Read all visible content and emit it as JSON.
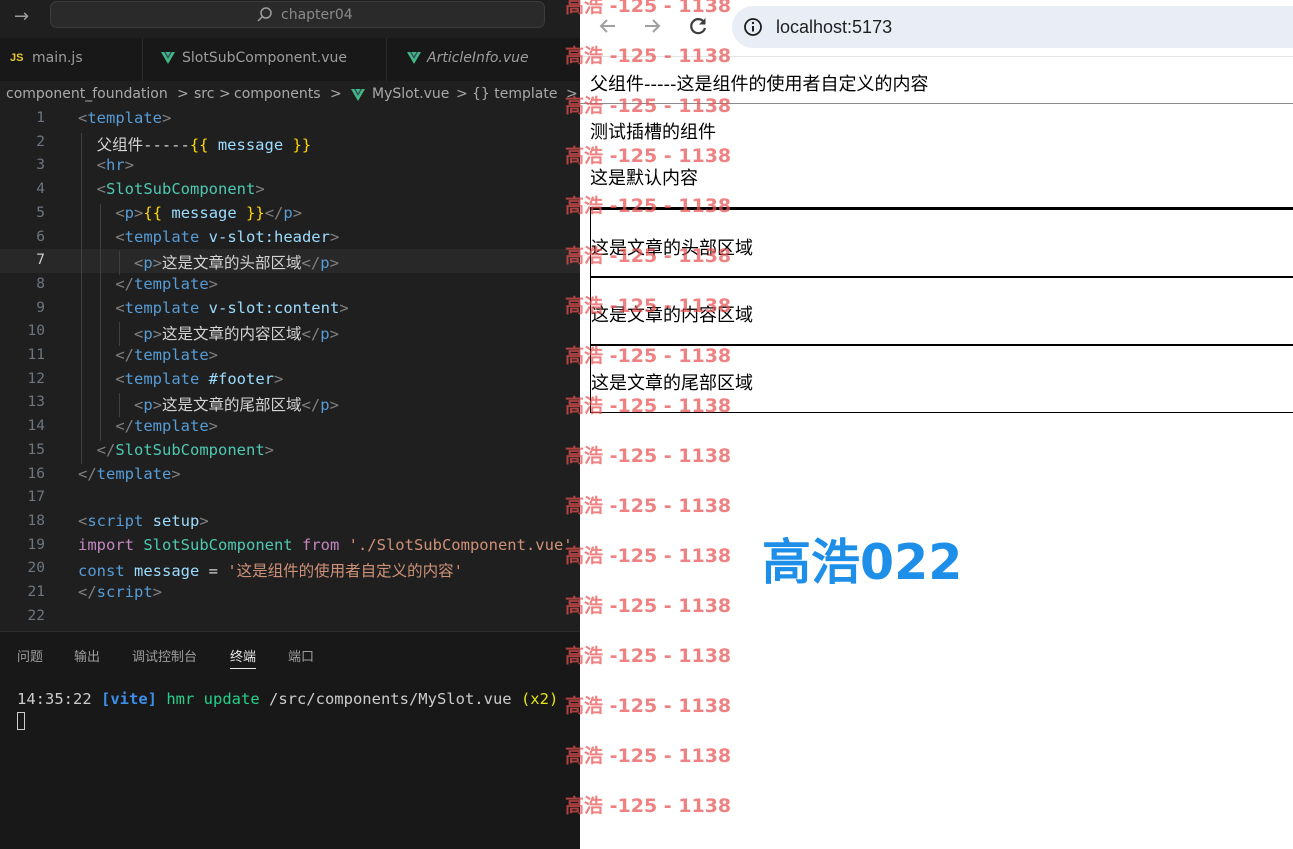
{
  "editor": {
    "command_center_title": "chapter04",
    "tabs": [
      {
        "label": "main.js",
        "type": "js"
      },
      {
        "label": "SlotSubComponent.vue",
        "type": "vue"
      },
      {
        "label": "ArticleInfo.vue",
        "type": "vue"
      }
    ],
    "breadcrumb": [
      "component_foundation",
      ">",
      "src",
      ">",
      "components",
      ">",
      "MySlot.vue",
      ">",
      "{} template",
      ">"
    ],
    "current_line": 7,
    "code_lines": [
      {
        "n": "1",
        "segs": [
          [
            "c-br",
            "<"
          ],
          [
            "c-tag",
            "template"
          ],
          [
            "c-br",
            ">"
          ]
        ]
      },
      {
        "n": "2",
        "segs": [
          [
            "c-txt",
            "  父组件-----"
          ],
          [
            "c-mus",
            "{{"
          ],
          [
            "c-var",
            " message "
          ],
          [
            "c-mus",
            "}}"
          ]
        ]
      },
      {
        "n": "3",
        "segs": [
          [
            "c-txt",
            "  "
          ],
          [
            "c-br",
            "<"
          ],
          [
            "c-tag",
            "hr"
          ],
          [
            "c-br",
            ">"
          ]
        ]
      },
      {
        "n": "4",
        "segs": [
          [
            "c-txt",
            "  "
          ],
          [
            "c-br",
            "<"
          ],
          [
            "c-comp",
            "SlotSubComponent"
          ],
          [
            "c-br",
            ">"
          ]
        ]
      },
      {
        "n": "5",
        "segs": [
          [
            "c-txt",
            "    "
          ],
          [
            "c-br",
            "<"
          ],
          [
            "c-tag",
            "p"
          ],
          [
            "c-br",
            ">"
          ],
          [
            "c-mus",
            "{{"
          ],
          [
            "c-var",
            " message "
          ],
          [
            "c-mus",
            "}}"
          ],
          [
            "c-br",
            "</"
          ],
          [
            "c-tag",
            "p"
          ],
          [
            "c-br",
            ">"
          ]
        ]
      },
      {
        "n": "6",
        "segs": [
          [
            "c-txt",
            "    "
          ],
          [
            "c-br",
            "<"
          ],
          [
            "c-tag",
            "template"
          ],
          [
            "c-attr",
            " v-slot:header"
          ],
          [
            "c-br",
            ">"
          ]
        ]
      },
      {
        "n": "7",
        "segs": [
          [
            "c-txt",
            "      "
          ],
          [
            "c-br",
            "<"
          ],
          [
            "c-tag",
            "p"
          ],
          [
            "c-br",
            ">"
          ],
          [
            "c-txt",
            "这是文章的头部区域"
          ],
          [
            "c-br",
            "</"
          ],
          [
            "c-tag",
            "p"
          ],
          [
            "c-br",
            ">"
          ]
        ]
      },
      {
        "n": "8",
        "segs": [
          [
            "c-txt",
            "    "
          ],
          [
            "c-br",
            "</"
          ],
          [
            "c-tag",
            "template"
          ],
          [
            "c-br",
            ">"
          ]
        ]
      },
      {
        "n": "9",
        "segs": [
          [
            "c-txt",
            "    "
          ],
          [
            "c-br",
            "<"
          ],
          [
            "c-tag",
            "template"
          ],
          [
            "c-attr",
            " v-slot:content"
          ],
          [
            "c-br",
            ">"
          ]
        ]
      },
      {
        "n": "10",
        "segs": [
          [
            "c-txt",
            "      "
          ],
          [
            "c-br",
            "<"
          ],
          [
            "c-tag",
            "p"
          ],
          [
            "c-br",
            ">"
          ],
          [
            "c-txt",
            "这是文章的内容区域"
          ],
          [
            "c-br",
            "</"
          ],
          [
            "c-tag",
            "p"
          ],
          [
            "c-br",
            ">"
          ]
        ]
      },
      {
        "n": "11",
        "segs": [
          [
            "c-txt",
            "    "
          ],
          [
            "c-br",
            "</"
          ],
          [
            "c-tag",
            "template"
          ],
          [
            "c-br",
            ">"
          ]
        ]
      },
      {
        "n": "12",
        "segs": [
          [
            "c-txt",
            "    "
          ],
          [
            "c-br",
            "<"
          ],
          [
            "c-tag",
            "template"
          ],
          [
            "c-attr",
            " #footer"
          ],
          [
            "c-br",
            ">"
          ]
        ]
      },
      {
        "n": "13",
        "segs": [
          [
            "c-txt",
            "      "
          ],
          [
            "c-br",
            "<"
          ],
          [
            "c-tag",
            "p"
          ],
          [
            "c-br",
            ">"
          ],
          [
            "c-txt",
            "这是文章的尾部区域"
          ],
          [
            "c-br",
            "</"
          ],
          [
            "c-tag",
            "p"
          ],
          [
            "c-br",
            ">"
          ]
        ]
      },
      {
        "n": "14",
        "segs": [
          [
            "c-txt",
            "    "
          ],
          [
            "c-br",
            "</"
          ],
          [
            "c-tag",
            "template"
          ],
          [
            "c-br",
            ">"
          ]
        ]
      },
      {
        "n": "15",
        "segs": [
          [
            "c-txt",
            "  "
          ],
          [
            "c-br",
            "</"
          ],
          [
            "c-comp",
            "SlotSubComponent"
          ],
          [
            "c-br",
            ">"
          ]
        ]
      },
      {
        "n": "16",
        "segs": [
          [
            "c-br",
            "</"
          ],
          [
            "c-tag",
            "template"
          ],
          [
            "c-br",
            ">"
          ]
        ]
      },
      {
        "n": "17",
        "segs": []
      },
      {
        "n": "18",
        "segs": [
          [
            "c-br",
            "<"
          ],
          [
            "c-tag",
            "script"
          ],
          [
            "c-attr",
            " setup"
          ],
          [
            "c-br",
            ">"
          ]
        ]
      },
      {
        "n": "19",
        "segs": [
          [
            "c-kw",
            "import"
          ],
          [
            "c-comp",
            " SlotSubComponent "
          ],
          [
            "c-kw",
            "from"
          ],
          [
            "c-str",
            " './SlotSubComponent.vue'"
          ]
        ]
      },
      {
        "n": "20",
        "segs": [
          [
            "c-kw2",
            "const"
          ],
          [
            "c-var",
            " message "
          ],
          [
            "c-txt",
            "= "
          ],
          [
            "c-str",
            "'这是组件的使用者自定义的内容'"
          ]
        ]
      },
      {
        "n": "21",
        "segs": [
          [
            "c-br",
            "</"
          ],
          [
            "c-tag",
            "script"
          ],
          [
            "c-br",
            ">"
          ]
        ]
      },
      {
        "n": "22",
        "segs": []
      }
    ],
    "panel_tabs": [
      "问题",
      "输出",
      "调试控制台",
      "终端",
      "端口"
    ],
    "active_panel_tab": "终端",
    "terminal": {
      "time": "14:35:22 ",
      "tag": "[vite]",
      "hmr": " hmr update ",
      "path": "/src/components/MySlot.vue ",
      "count": "(x2)"
    }
  },
  "browser": {
    "url": "localhost:5173",
    "parent_text": "父组件-----这是组件的使用者自定义的内容",
    "child_title": "测试插槽的组件",
    "default_text": "这是默认内容",
    "header_text": "这是文章的头部区域",
    "content_text": "这是文章的内容区域",
    "footer_text": "这是文章的尾部区域"
  },
  "watermark": {
    "repeat_text": "高浩 -125 - 1138",
    "big_text": "高浩022"
  }
}
